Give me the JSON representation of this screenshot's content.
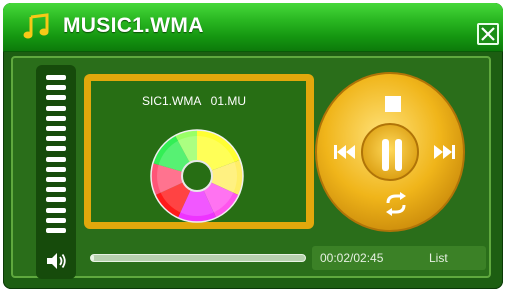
{
  "window": {
    "title": "MUSIC1.WMA",
    "icons": {
      "title": "music-note-icon",
      "close": "close-icon"
    }
  },
  "display": {
    "track_text": "SIC1.WMA   01.MU",
    "disc_icon": "cd-disc-icon"
  },
  "volume": {
    "level_fraction": 1.0,
    "bars": 16,
    "icon": "speaker-icon"
  },
  "controls": {
    "icons": [
      "stop-icon",
      "previous-icon",
      "pause-icon",
      "next-icon",
      "repeat-icon"
    ]
  },
  "progress": {
    "fraction": 0.012,
    "time": "00:02/02:45",
    "list_label": "List"
  },
  "colors": {
    "titlebar": "#2ab822",
    "background": "#1d5e12",
    "accent_gold": "#e2a80c",
    "display": "#276e14"
  }
}
